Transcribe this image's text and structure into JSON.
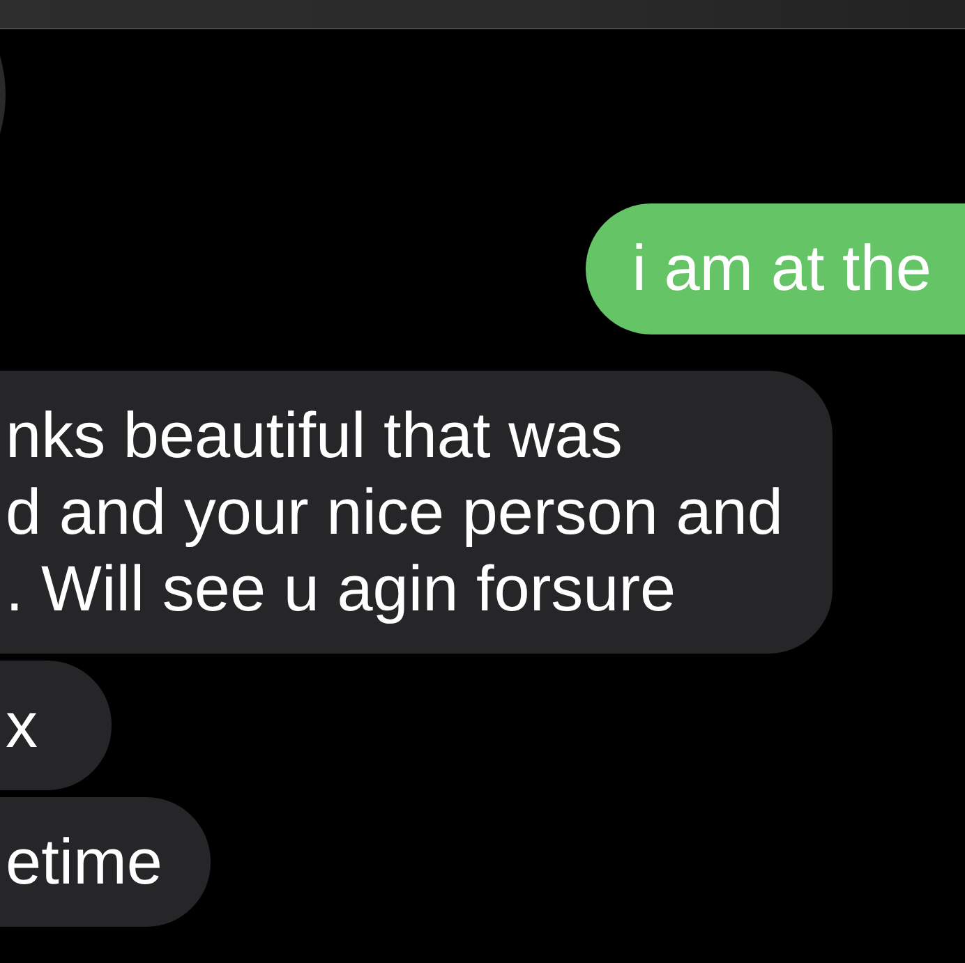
{
  "messages": [
    {
      "kind": "received"
    },
    {
      "kind": "sent",
      "text": "i am at the"
    },
    {
      "kind": "received",
      "text": "nks beautiful that was\nd and your nice person and\n. Will see u agin forsure"
    },
    {
      "kind": "received",
      "text": "x"
    },
    {
      "kind": "received",
      "text": "etime"
    }
  ]
}
